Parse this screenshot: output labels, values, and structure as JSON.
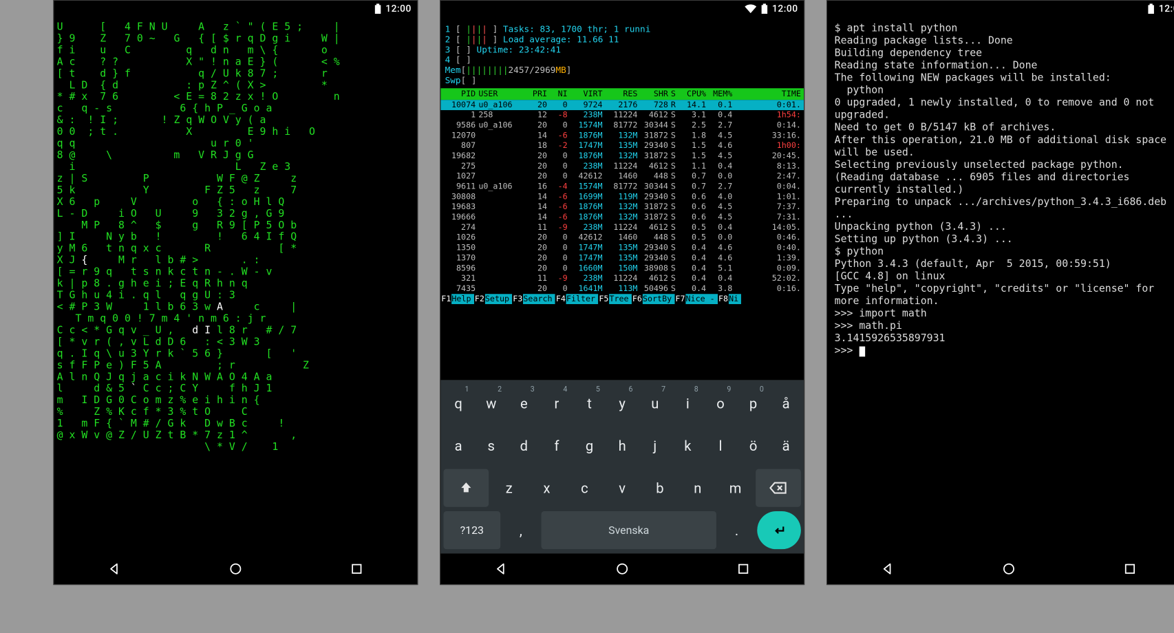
{
  "status": {
    "time": "12:00"
  },
  "screen1": {
    "matrix_rows": [
      "U      [   4 F N U     A   z ` \" ( E 5 ;     |",
      "} 9    Z   7 0 ~   G   { [ $ r q D g i     W |",
      "f i    u   C         q   d n   m \\ {       o",
      "A c    ? ?           X \" ! n a E } (       < %",
      "[ t    d } f           q / U k 8 7 ;       r",
      "  L D  { d           : p Z ^ ( X >         *",
      "* # x  7 6         < E = 8 2 z x ! O         n",
      "c   q - s           6 { h P _ G o a",
      "& :  ! I ;       ! Z q W O V y ( a",
      "0 0  ; t .           X         E 9 h i   O",
      "q q                      u r 0 '",
      "8 @     \\          m   V R J g G",
      "  i                          L   Z e 3",
      "z | S         P           W F @ Z     z",
      "5 k           Y         F Z 5   z     7",
      "X 6   p     V         o   { : o H l Q",
      "L - D     i O   U     9   3 2 g , G 9",
      "    M P   8 ^   $     g   R 9 [ P 5 O b",
      "] I     N y b   !         !   6 4 I f Q",
      "y M 6   t n q x c       R           [ *",
      "X J {     M r   l b # >       . :",
      "[ = r 9 q   t s n k c t n - . W - v",
      "k | p 8 . g h e i ; E q R h n q",
      "T G h u 4 i . q l   q g U : 3",
      "< # P 3 W     1 l b 6 3 w A     c     |",
      "   T m q 0 0 ! 7 m 4 ' n m 6 : j r",
      "C c < * G q v _ U ,   d I l 8 r   # / 7",
      "[ * v r ( , v L d D 6   : < 3 W 3",
      "q . I q \\ u 3 Y r k ` 5 6 }       [   '",
      "s f F P e ) F 5 A         ; r           Z",
      "A l n Q J q j a c i k N W A O 4 A a",
      "l     d & 5 ` C c ; C Y     f h J 1",
      "m   I D G 0 C o m z % e i h i n {",
      "%     Z % K c f * 3 % t O     C",
      "1   m F { ` M # / G k   D w B c     !",
      "@ x W v @ Z / U Z t B * 7 z 1 ^       ,",
      "                        \\ * V /    1"
    ],
    "white_positions": {
      "1": [
        16
      ],
      "2": [
        22
      ],
      "6": [
        30
      ],
      "8": [
        18,
        22
      ],
      "13": [
        24
      ],
      "20": [
        4
      ],
      "24": [
        26
      ],
      "26": [
        22,
        24
      ],
      "31": [
        12
      ]
    }
  },
  "screen2": {
    "summary": {
      "cpu_rows": [
        "1",
        "2",
        "3",
        "4"
      ],
      "mem_line": "Mem[||||||||2457/2969MB]",
      "swp_line": "Swp[                  ]",
      "tasks": "Tasks: 83, 1700 thr; 1 runni",
      "load": "Load average:      11.66 11",
      "uptime": "Uptime: 23:42:41"
    },
    "columns": [
      "PID",
      "USER",
      "PRI",
      "NI",
      "VIRT",
      "RES",
      "SHR",
      "S",
      "CPU%",
      "MEM%",
      "TIME"
    ],
    "rows": [
      {
        "sel": true,
        "pid": "10074",
        "user": "u0_a106",
        "pri": "20",
        "ni": "0",
        "virt": "9724",
        "res": "2176",
        "shr": "728",
        "s": "R",
        "cpu": "14.1",
        "mem": "0.1",
        "time": "0:01."
      },
      {
        "pid": "1",
        "user": "258",
        "pri": "12",
        "ni": "-8",
        "virt": "238M",
        "res": "11224",
        "shr": "4612",
        "s": "S",
        "cpu": "3.1",
        "mem": "0.4",
        "time": "1h54:",
        "tred": true,
        "nneg": true
      },
      {
        "pid": "9586",
        "user": "u0_a106",
        "pri": "20",
        "ni": "0",
        "virt": "1574M",
        "res": "81772",
        "shr": "30344",
        "s": "S",
        "cpu": "2.5",
        "mem": "2.7",
        "time": "0:14."
      },
      {
        "pid": "12070",
        "user": "",
        "pri": "14",
        "ni": "-6",
        "virt": "1876M",
        "res": "132M",
        "shr": "31872",
        "s": "S",
        "cpu": "1.8",
        "mem": "4.5",
        "time": "33:16.",
        "nneg": true
      },
      {
        "pid": "807",
        "user": "",
        "pri": "18",
        "ni": "-2",
        "virt": "1747M",
        "res": "135M",
        "shr": "29340",
        "s": "S",
        "cpu": "1.5",
        "mem": "4.6",
        "time": "1h00:",
        "tred": true,
        "nneg": true
      },
      {
        "pid": "19682",
        "user": "",
        "pri": "20",
        "ni": "0",
        "virt": "1876M",
        "res": "132M",
        "shr": "31872",
        "s": "S",
        "cpu": "1.5",
        "mem": "4.5",
        "time": "20:45."
      },
      {
        "pid": "275",
        "user": "",
        "pri": "20",
        "ni": "0",
        "virt": "238M",
        "res": "11224",
        "shr": "4612",
        "s": "S",
        "cpu": "1.1",
        "mem": "0.4",
        "time": "8:13."
      },
      {
        "pid": "1027",
        "user": "",
        "pri": "20",
        "ni": "0",
        "virt": "42612",
        "res": "1460",
        "shr": "448",
        "s": "S",
        "cpu": "0.7",
        "mem": "0.0",
        "time": "2:47."
      },
      {
        "pid": "9611",
        "user": "u0_a106",
        "pri": "16",
        "ni": "-4",
        "virt": "1574M",
        "res": "81772",
        "shr": "30344",
        "s": "S",
        "cpu": "0.7",
        "mem": "2.7",
        "time": "0:04.",
        "nneg": true
      },
      {
        "pid": "30808",
        "user": "",
        "pri": "14",
        "ni": "-6",
        "virt": "1699M",
        "res": "119M",
        "shr": "29340",
        "s": "S",
        "cpu": "0.6",
        "mem": "4.0",
        "time": "1:01.",
        "nneg": true
      },
      {
        "pid": "19683",
        "user": "",
        "pri": "14",
        "ni": "-6",
        "virt": "1876M",
        "res": "132M",
        "shr": "31872",
        "s": "S",
        "cpu": "0.6",
        "mem": "4.5",
        "time": "7:37.",
        "nneg": true
      },
      {
        "pid": "19666",
        "user": "",
        "pri": "14",
        "ni": "-6",
        "virt": "1876M",
        "res": "132M",
        "shr": "31872",
        "s": "S",
        "cpu": "0.6",
        "mem": "4.5",
        "time": "7:31.",
        "nneg": true
      },
      {
        "pid": "274",
        "user": "",
        "pri": "11",
        "ni": "-9",
        "virt": "238M",
        "res": "11224",
        "shr": "4612",
        "s": "S",
        "cpu": "0.5",
        "mem": "0.4",
        "time": "14:05.",
        "nneg": true
      },
      {
        "pid": "1026",
        "user": "",
        "pri": "20",
        "ni": "0",
        "virt": "42612",
        "res": "1460",
        "shr": "448",
        "s": "S",
        "cpu": "0.5",
        "mem": "0.0",
        "time": "0:46."
      },
      {
        "pid": "1350",
        "user": "",
        "pri": "20",
        "ni": "0",
        "virt": "1747M",
        "res": "135M",
        "shr": "29340",
        "s": "S",
        "cpu": "0.4",
        "mem": "4.6",
        "time": "0:40."
      },
      {
        "pid": "1370",
        "user": "",
        "pri": "20",
        "ni": "0",
        "virt": "1747M",
        "res": "135M",
        "shr": "29340",
        "s": "S",
        "cpu": "0.4",
        "mem": "4.6",
        "time": "1:39."
      },
      {
        "pid": "8596",
        "user": "",
        "pri": "20",
        "ni": "0",
        "virt": "1660M",
        "res": "150M",
        "shr": "38908",
        "s": "S",
        "cpu": "0.4",
        "mem": "5.1",
        "time": "0:09."
      },
      {
        "pid": "321",
        "user": "",
        "pri": "11",
        "ni": "-9",
        "virt": "238M",
        "res": "11224",
        "shr": "4612",
        "s": "S",
        "cpu": "0.4",
        "mem": "0.4",
        "time": "52:02.",
        "nneg": true
      },
      {
        "pid": "7435",
        "user": "",
        "pri": "20",
        "ni": "0",
        "virt": "1641M",
        "res": "113M",
        "shr": "50496",
        "s": "S",
        "cpu": "0.4",
        "mem": "3.8",
        "time": "0:16."
      }
    ],
    "fkeys": [
      {
        "k": "F1",
        "l": "Help"
      },
      {
        "k": "F2",
        "l": "Setup"
      },
      {
        "k": "F3",
        "l": "Search"
      },
      {
        "k": "F4",
        "l": "Filter"
      },
      {
        "k": "F5",
        "l": "Tree"
      },
      {
        "k": "F6",
        "l": "SortBy"
      },
      {
        "k": "F7",
        "l": "Nice -"
      },
      {
        "k": "F8",
        "l": "Ni"
      }
    ],
    "keyboard": {
      "row1": [
        {
          "g": "q",
          "h": "1"
        },
        {
          "g": "w",
          "h": "2"
        },
        {
          "g": "e",
          "h": "3"
        },
        {
          "g": "r",
          "h": "4"
        },
        {
          "g": "t",
          "h": "5"
        },
        {
          "g": "y",
          "h": "6"
        },
        {
          "g": "u",
          "h": "7"
        },
        {
          "g": "i",
          "h": "8"
        },
        {
          "g": "o",
          "h": "9"
        },
        {
          "g": "p",
          "h": "0"
        },
        {
          "g": "å",
          "h": ""
        }
      ],
      "row2": [
        {
          "g": "a"
        },
        {
          "g": "s"
        },
        {
          "g": "d"
        },
        {
          "g": "f"
        },
        {
          "g": "g"
        },
        {
          "g": "h"
        },
        {
          "g": "j"
        },
        {
          "g": "k"
        },
        {
          "g": "l"
        },
        {
          "g": "ö"
        },
        {
          "g": "ä"
        }
      ],
      "row3_letters": [
        {
          "g": "z"
        },
        {
          "g": "x"
        },
        {
          "g": "c"
        },
        {
          "g": "v"
        },
        {
          "g": "b"
        },
        {
          "g": "n"
        },
        {
          "g": "m"
        }
      ],
      "row4": {
        "sym": "?123",
        "comma": ",",
        "space": "Svenska",
        "dot": "."
      }
    }
  },
  "screen3": {
    "lines": [
      "$ apt install python",
      "Reading package lists... Done",
      "Building dependency tree",
      "Reading state information... Done",
      "The following NEW packages will be installed:",
      "  python",
      "0 upgraded, 1 newly installed, 0 to remove and 0 not upgraded.",
      "Need to get 0 B/5147 kB of archives.",
      "After this operation, 21.0 MB of additional disk space will be used.",
      "Selecting previously unselected package python.",
      "(Reading database ... 6905 files and directories currently installed.)",
      "Preparing to unpack .../archives/python_3.4.3_i686.deb ...",
      "Unpacking python (3.4.3) ...",
      "Setting up python (3.4.3) ...",
      "$ python",
      "Python 3.4.3 (default, Apr  5 2015, 00:59:51)",
      "[GCC 4.8] on linux",
      "Type \"help\", \"copyright\", \"credits\" or \"license\" for more information.",
      ">>> import math",
      ">>> math.pi",
      "3.1415926535897931",
      ">>> "
    ]
  }
}
